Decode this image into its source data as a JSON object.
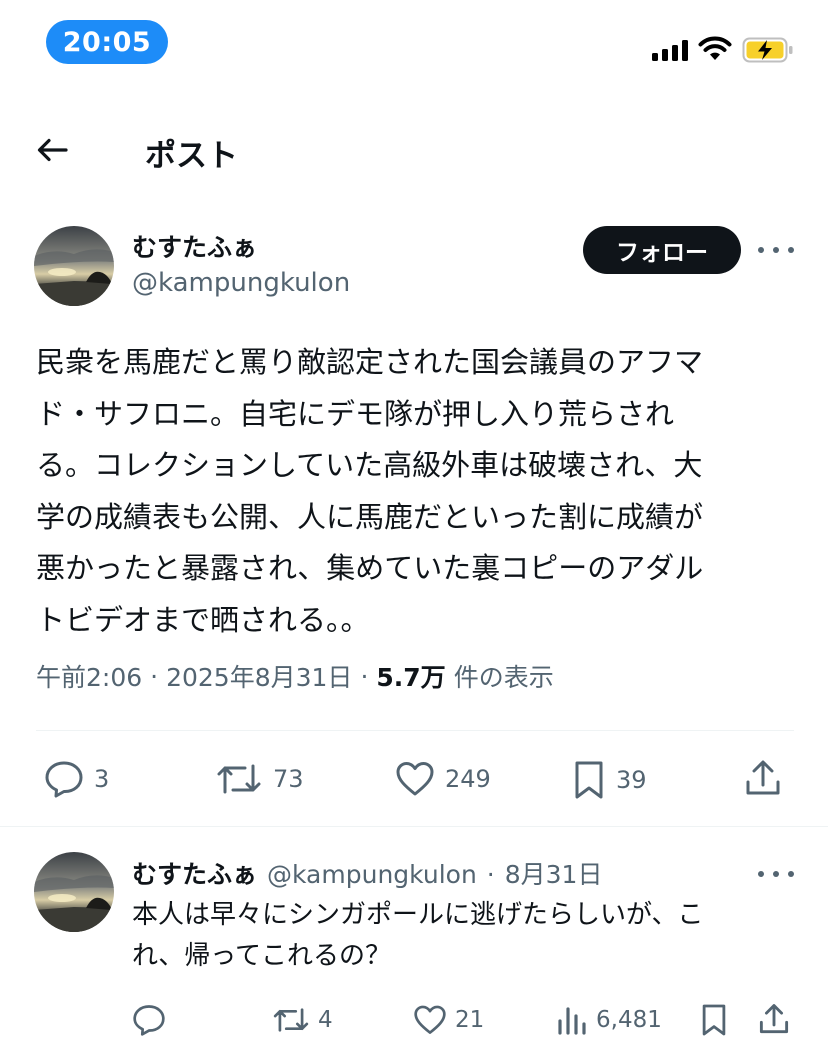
{
  "status_bar": {
    "time": "20:05"
  },
  "header": {
    "title": "ポスト"
  },
  "tweet": {
    "display_name": "むすたふぁ",
    "handle": "@kampungkulon",
    "follow_label": "フォロー",
    "text": "民衆を馬鹿だと罵り敵認定された国会議員のアフマ\nド・サフロニ。自宅にデモ隊が押し入り荒らされ\nる。コレクションしていた高級外車は破壊され、大\n学の成績表も公開、人に馬鹿だといった割に成績が\n悪かったと暴露され、集めていた裏コピーのアダル\nトビデオまで晒される。。",
    "time": "午前2:06",
    "date": "2025年8月31日",
    "views_count": "5.7万",
    "views_label": "件の表示",
    "separator": "·",
    "stats": {
      "replies": "3",
      "reposts": "73",
      "likes": "249",
      "bookmarks": "39"
    }
  },
  "reply": {
    "display_name": "むすたふぁ",
    "handle": "@kampungkulon",
    "separator": "·",
    "date": "8月31日",
    "text": "本人は早々にシンガポールに逃げたらしいが、こ\nれ、帰ってこれるの？",
    "stats": {
      "replies": "",
      "reposts": "4",
      "likes": "21",
      "views": "6,481"
    }
  },
  "icons": {
    "back": "arrow-left-icon",
    "more": "more-horizontal-icon",
    "reply": "speech-bubble-icon",
    "repost": "repost-arrows-icon",
    "like": "heart-icon",
    "bookmark": "bookmark-icon",
    "share": "share-upload-icon",
    "views": "bar-chart-icon"
  },
  "colors": {
    "accent": "#1d8cf8",
    "text": "#0f1419",
    "secondary": "#536471",
    "battery": "#f7d02a"
  }
}
